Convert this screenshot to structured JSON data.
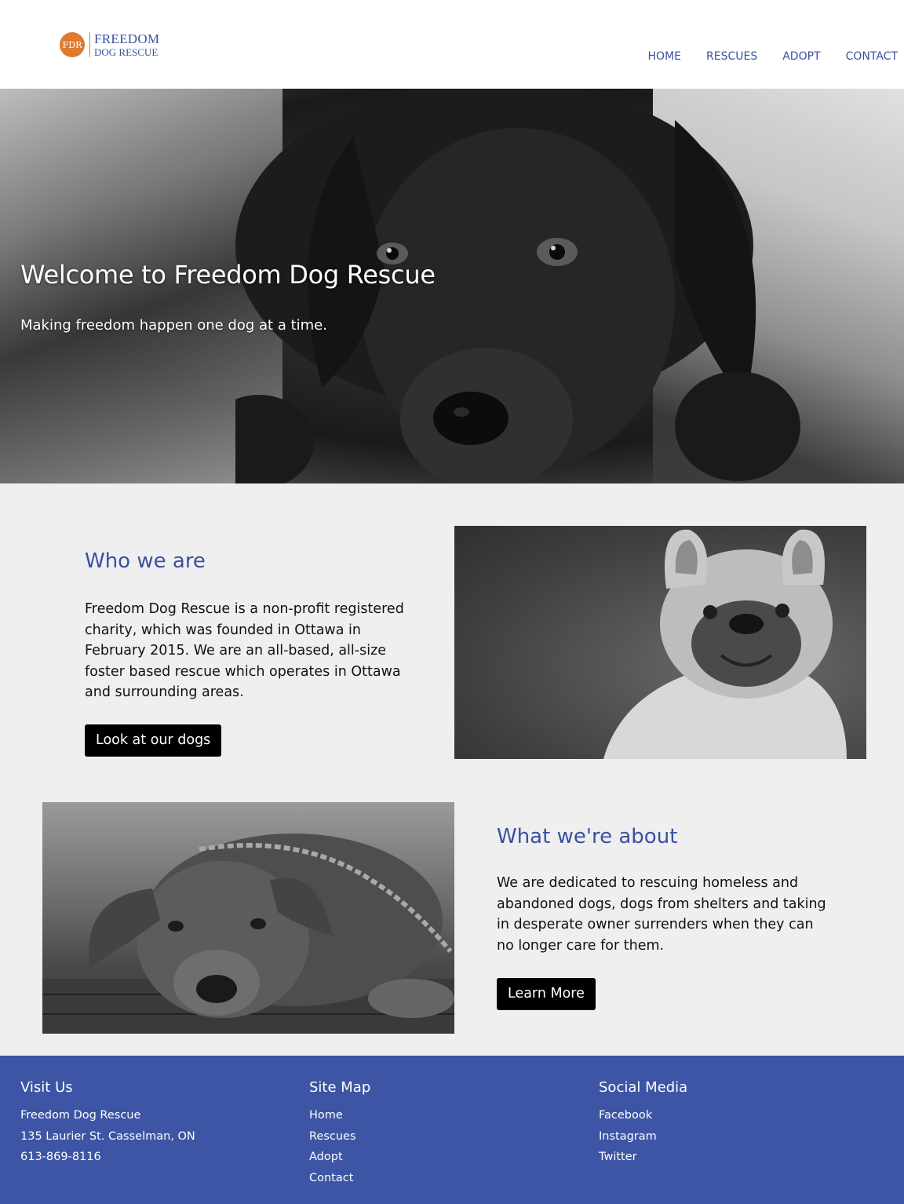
{
  "header": {
    "logo": {
      "badge": "FDR",
      "line1": "FREEDOM",
      "line2": "DOG RESCUE"
    },
    "nav": [
      {
        "label": "HOME"
      },
      {
        "label": "RESCUES"
      },
      {
        "label": "ADOPT"
      },
      {
        "label": "CONTACT"
      }
    ]
  },
  "hero": {
    "title": "Welcome to Freedom Dog Rescue",
    "subtitle": "Making freedom happen one dog at a time."
  },
  "who": {
    "heading": "Who we are",
    "text": "Freedom Dog Rescue is a non-profit registered charity, which was founded in Ottawa in February 2015. We are an all-based, all-size foster based rescue which operates in Ottawa and surrounding areas.",
    "button": "Look at our dogs"
  },
  "about": {
    "heading": "What we're about",
    "text": "We are dedicated to rescuing homeless and abandoned dogs, dogs from shelters and taking in desperate owner surrenders when they can no longer care for them.",
    "button": "Learn More"
  },
  "footer": {
    "visit": {
      "heading": "Visit Us",
      "lines": [
        "Freedom Dog Rescue",
        "135 Laurier St. Casselman, ON",
        "613-869-8116"
      ]
    },
    "sitemap": {
      "heading": "Site Map",
      "links": [
        "Home",
        "Rescues",
        "Adopt",
        "Contact"
      ]
    },
    "social": {
      "heading": "Social Media",
      "links": [
        "Facebook",
        "Instagram",
        "Twitter"
      ]
    }
  },
  "colors": {
    "brand_blue": "#3a50a1",
    "footer_blue": "#3d55a4",
    "logo_orange": "#e07b2e",
    "section_bg": "#efefef"
  }
}
